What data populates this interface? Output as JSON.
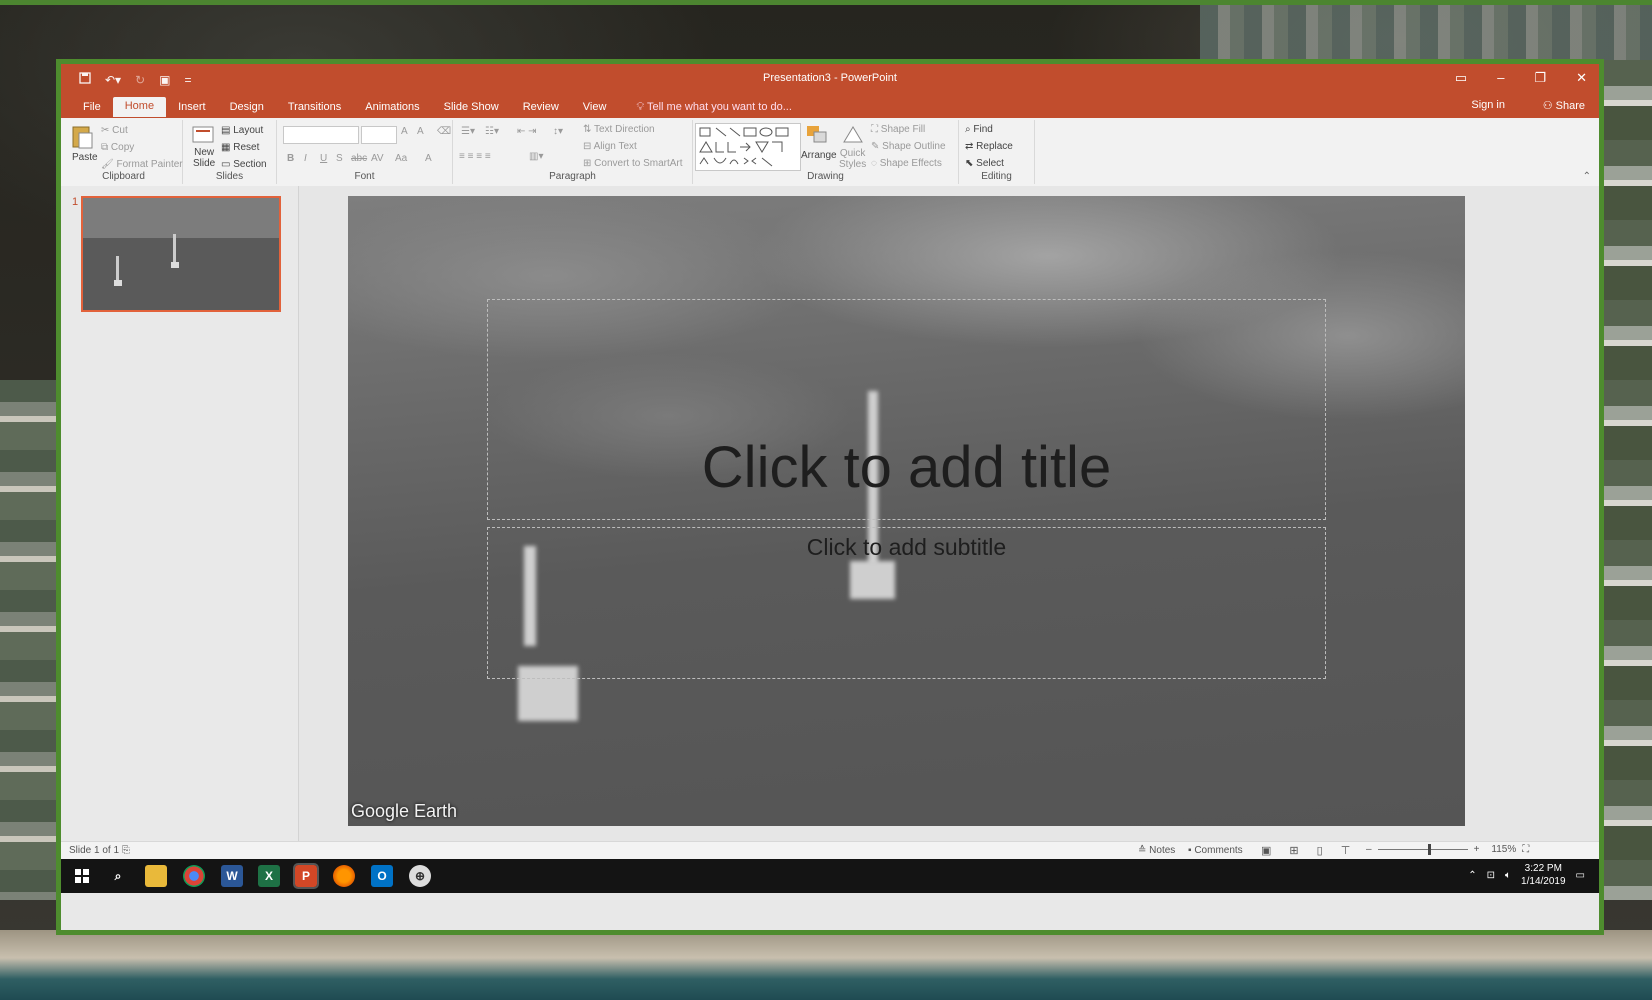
{
  "window": {
    "title": "Presentation3 - PowerPoint"
  },
  "qat": {
    "save_icon": "save-icon",
    "undo_icon": "undo-icon",
    "redo_icon": "redo-icon",
    "present_icon": "present-from-start-icon",
    "customize": "="
  },
  "tabs": [
    {
      "label": "File"
    },
    {
      "label": "Home"
    },
    {
      "label": "Insert"
    },
    {
      "label": "Design"
    },
    {
      "label": "Transitions"
    },
    {
      "label": "Animations"
    },
    {
      "label": "Slide Show"
    },
    {
      "label": "Review"
    },
    {
      "label": "View"
    }
  ],
  "tellme": "Tell me what you want to do...",
  "account": {
    "signin": "Sign in",
    "share": "Share"
  },
  "ribbon": {
    "clipboard": {
      "label": "Clipboard",
      "paste": "Paste",
      "cut": "Cut",
      "copy": "Copy",
      "format_painter": "Format Painter"
    },
    "slides": {
      "label": "Slides",
      "new_slide_1": "New",
      "new_slide_2": "Slide",
      "layout": "Layout",
      "reset": "Reset",
      "section": "Section"
    },
    "font": {
      "label": "Font",
      "bold": "B",
      "italic": "I",
      "underline": "U",
      "shadow": "S",
      "strike": "abc",
      "spacing": "AV",
      "case": "Aa",
      "color": "A",
      "grow": "A",
      "shrink": "A"
    },
    "paragraph": {
      "label": "Paragraph",
      "text_direction": "Text Direction",
      "align_text": "Align Text",
      "convert_smartart": "Convert to SmartArt"
    },
    "drawing": {
      "label": "Drawing",
      "arrange": "Arrange",
      "quick_styles_1": "Quick",
      "quick_styles_2": "Styles",
      "shape_fill": "Shape Fill",
      "shape_outline": "Shape Outline",
      "shape_effects": "Shape Effects"
    },
    "editing": {
      "label": "Editing",
      "find": "Find",
      "replace": "Replace",
      "select": "Select"
    }
  },
  "thumbnail": {
    "number": "1"
  },
  "slide": {
    "title_placeholder": "Click to add title",
    "subtitle_placeholder": "Click to add subtitle",
    "watermark": "Google Earth"
  },
  "status": {
    "slide_count": "Slide 1 of 1",
    "notes": "Notes",
    "comments": "Comments",
    "zoom": "115%"
  },
  "taskbar": {
    "time": "3:22 PM",
    "date": "1/14/2019"
  },
  "colors": {
    "accent": "#c14d2d",
    "frame": "#4e8c2e"
  }
}
